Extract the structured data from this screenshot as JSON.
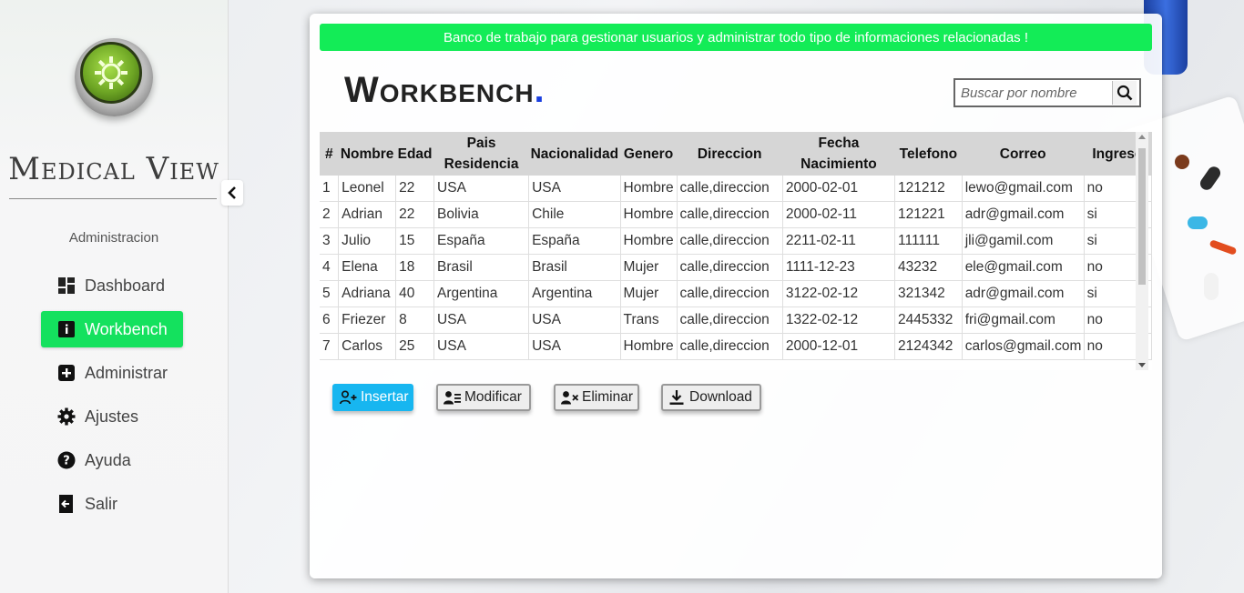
{
  "brand": {
    "name": "Medical View"
  },
  "sidebar": {
    "section_label": "Administracion",
    "items": [
      {
        "label": "Dashboard",
        "icon": "dashboard-icon",
        "active": false
      },
      {
        "label": "Workbench",
        "icon": "info-icon",
        "active": true
      },
      {
        "label": "Administrar",
        "icon": "plus-square-icon",
        "active": false
      },
      {
        "label": "Ajustes",
        "icon": "gear-icon",
        "active": false
      },
      {
        "label": "Ayuda",
        "icon": "help-circle-icon",
        "active": false
      },
      {
        "label": "Salir",
        "icon": "exit-icon",
        "active": false
      }
    ]
  },
  "main": {
    "banner": "Banco de trabajo para gestionar usuarios y administrar todo tipo de informaciones relacionadas !",
    "title": "Workbench",
    "title_dot": ".",
    "search": {
      "placeholder": "Buscar por nombre",
      "value": ""
    }
  },
  "table": {
    "headers": [
      "#",
      "Nombre",
      "Edad",
      "Pais Residencia",
      "Nacionalidad",
      "Genero",
      "Direccion",
      "Fecha Nacimiento",
      "Telefono",
      "Correo",
      "Ingreso"
    ],
    "rows": [
      [
        "1",
        "Leonel",
        "22",
        "USA",
        "USA",
        "Hombre",
        "calle,direccion",
        "2000-02-01",
        "121212",
        "lewo@gmail.com",
        "no"
      ],
      [
        "2",
        "Adrian",
        "22",
        "Bolivia",
        "Chile",
        "Hombre",
        "calle,direccion",
        "2000-02-11",
        "121221",
        "adr@gmail.com",
        "si"
      ],
      [
        "3",
        "Julio",
        "15",
        "España",
        "España",
        "Hombre",
        "calle,direccion",
        "2211-02-11",
        "111111",
        "jli@gamil.com",
        "si"
      ],
      [
        "4",
        "Elena",
        "18",
        "Brasil",
        "Brasil",
        "Mujer",
        "calle,direccion",
        "1111-12-23",
        "43232",
        "ele@gmail.com",
        "no"
      ],
      [
        "5",
        "Adriana",
        "40",
        "Argentina",
        "Argentina",
        "Mujer",
        "calle,direccion",
        "3122-02-12",
        "321342",
        "adr@gmail.com",
        "si"
      ],
      [
        "6",
        "Friezer",
        "8",
        "USA",
        "USA",
        "Trans",
        "calle,direccion",
        "1322-02-12",
        "2445332",
        "fri@gmail.com",
        "no"
      ],
      [
        "7",
        "Carlos",
        "25",
        "USA",
        "USA",
        "Hombre",
        "calle,direccion",
        "2000-12-01",
        "2124342",
        "carlos@gmail.com",
        "no"
      ]
    ]
  },
  "actions": {
    "insert_label": "Insertar",
    "modify_label": "Modificar",
    "delete_label": "Eliminar",
    "download_label": "Download"
  },
  "colors": {
    "accent_green": "#14e15e",
    "banner_green": "#13ec57",
    "insert_blue": "#17b6f0",
    "title_dot_blue": "#1a3fe0"
  }
}
